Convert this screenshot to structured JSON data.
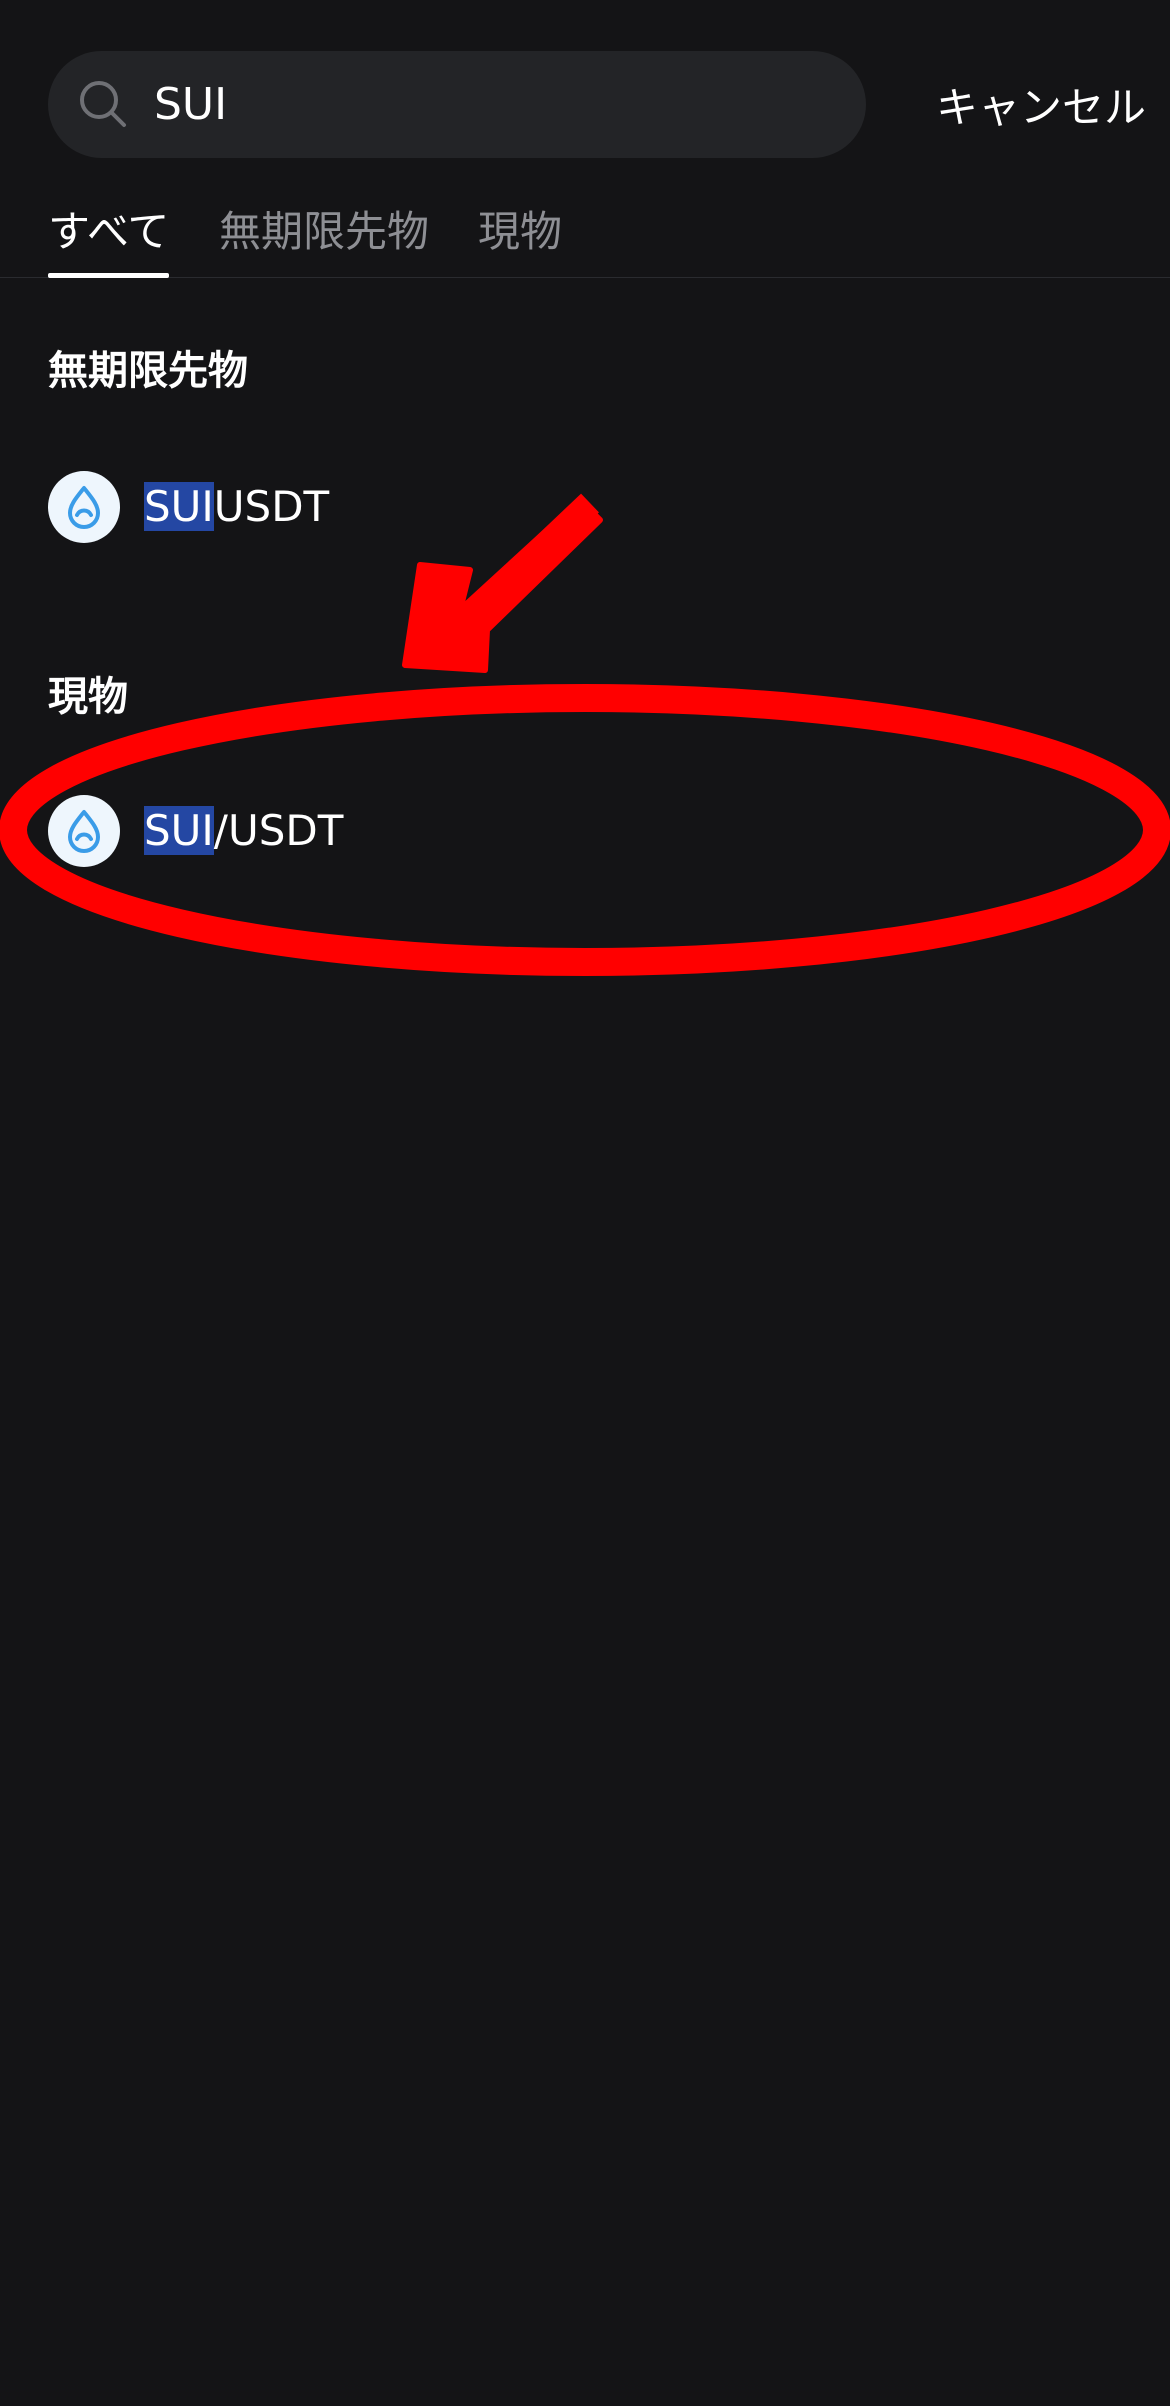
{
  "search": {
    "value": "SUI",
    "cancel_label": "キャンセル"
  },
  "tabs": [
    {
      "label": "すべて",
      "active": true
    },
    {
      "label": "無期限先物",
      "active": false
    },
    {
      "label": "現物",
      "active": false
    }
  ],
  "sections": {
    "perpetual": {
      "title": "無期限先物",
      "result": {
        "highlight": "SUI",
        "rest": "USDT",
        "icon": "sui-drop-icon"
      }
    },
    "spot": {
      "title": "現物",
      "result": {
        "highlight": "SUI",
        "rest": "/USDT",
        "icon": "sui-drop-icon"
      }
    }
  },
  "colors": {
    "background": "#141416",
    "search_bg": "#232427",
    "highlight": "#2447a3",
    "coin_accent": "#3a9ce8",
    "annotation": "#ff0000"
  }
}
